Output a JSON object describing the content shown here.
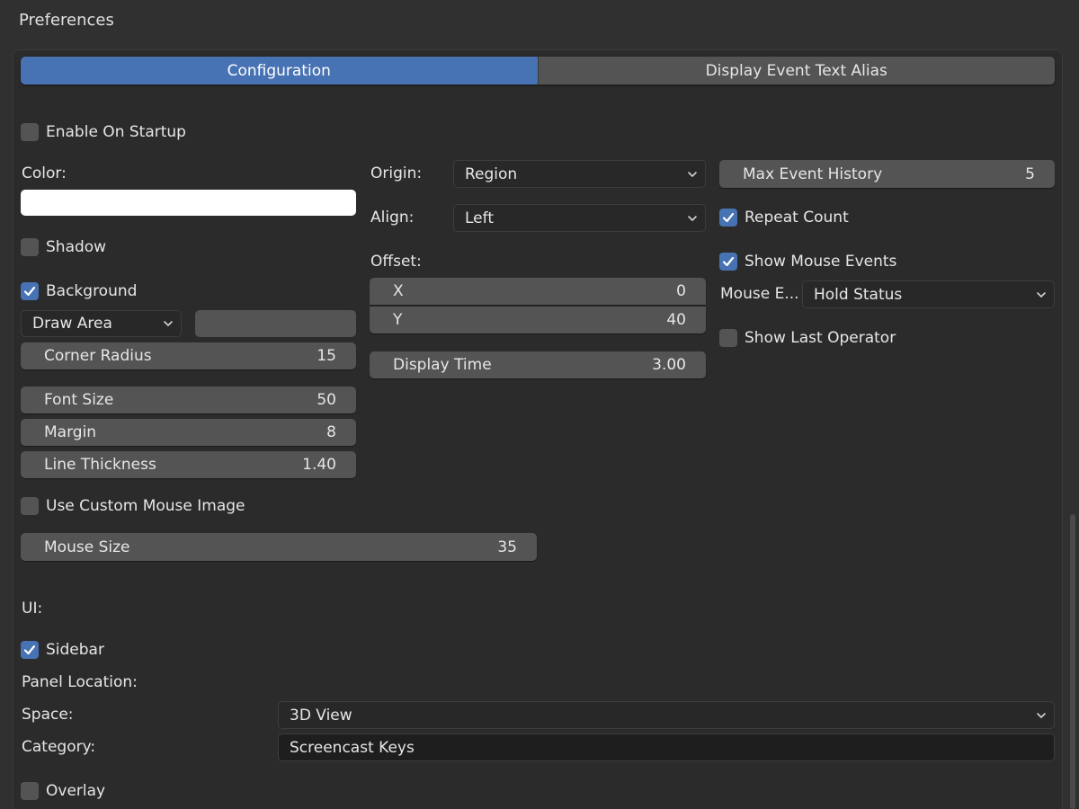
{
  "header": {
    "title": "Preferences"
  },
  "tabs": [
    {
      "label": "Configuration",
      "active": true
    },
    {
      "label": "Display Event Text Alias",
      "active": false
    }
  ],
  "enable_on_startup": {
    "label": "Enable On Startup",
    "checked": false
  },
  "color": {
    "label": "Color:",
    "value": "#ffffff"
  },
  "shadow": {
    "label": "Shadow",
    "checked": false
  },
  "background": {
    "label": "Background",
    "checked": true
  },
  "draw_area": {
    "value": "Draw Area"
  },
  "corner_radius": {
    "label": "Corner Radius",
    "value": "15"
  },
  "font_size": {
    "label": "Font Size",
    "value": "50"
  },
  "margin": {
    "label": "Margin",
    "value": "8"
  },
  "line_thickness": {
    "label": "Line Thickness",
    "value": "1.40"
  },
  "custom_mouse_image": {
    "label": "Use Custom Mouse Image",
    "checked": false
  },
  "mouse_size": {
    "label": "Mouse Size",
    "value": "35"
  },
  "origin": {
    "label": "Origin:",
    "value": "Region"
  },
  "align": {
    "label": "Align:",
    "value": "Left"
  },
  "offset": {
    "label": "Offset:",
    "x_label": "X",
    "x_value": "0",
    "y_label": "Y",
    "y_value": "40"
  },
  "display_time": {
    "label": "Display Time",
    "value": "3.00"
  },
  "max_event_history": {
    "label": "Max Event History",
    "value": "5"
  },
  "repeat_count": {
    "label": "Repeat Count",
    "checked": true
  },
  "show_mouse_events": {
    "label": "Show Mouse Events",
    "checked": true
  },
  "mouse_events_mode": {
    "label": "Mouse E...",
    "value": "Hold Status"
  },
  "show_last_operator": {
    "label": "Show Last Operator",
    "checked": false
  },
  "ui": {
    "label": "UI:"
  },
  "sidebar": {
    "label": "Sidebar",
    "checked": true
  },
  "panel_location": {
    "label": "Panel Location:"
  },
  "space": {
    "label": "Space:",
    "value": "3D View"
  },
  "category": {
    "label": "Category:",
    "value": "Screencast Keys"
  },
  "overlay": {
    "label": "Overlay",
    "checked": false
  },
  "colors": {
    "accent": "#4772b3",
    "widget": "#545454",
    "panel": "#2b2b2b",
    "background": "#303030"
  }
}
